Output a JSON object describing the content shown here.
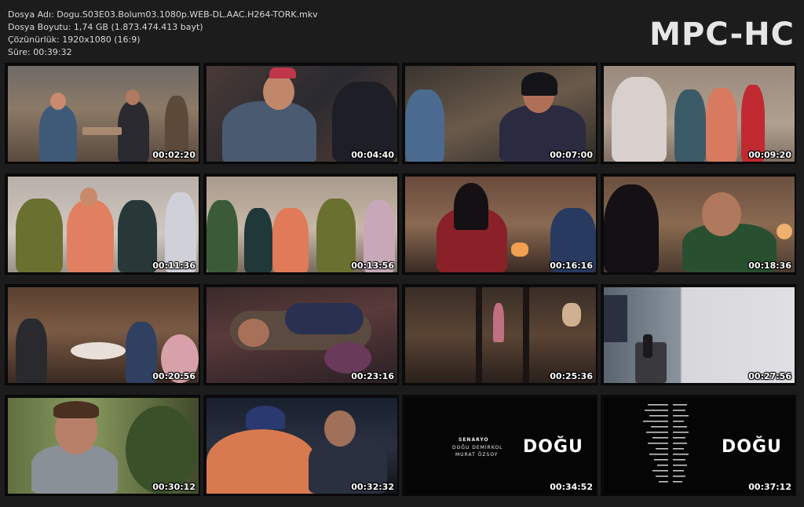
{
  "file_info": {
    "name_line": "Dosya Adı: Dogu.S03E03.Bolum03.1080p.WEB-DL.AAC.H264-TORK.mkv",
    "size_line": "Dosya Boyutu: 1,74 GB (1.873.474.413 bayt)",
    "resolution_line": "Çözünürlük: 1920x1080 (16:9)",
    "duration_line": "Süre: 00:39:32"
  },
  "logo": "MPC-HC",
  "thumbnails": [
    {
      "time": "00:02:20"
    },
    {
      "time": "00:04:40"
    },
    {
      "time": "00:07:00"
    },
    {
      "time": "00:09:20"
    },
    {
      "time": "00:11:36"
    },
    {
      "time": "00:13:56"
    },
    {
      "time": "00:16:16"
    },
    {
      "time": "00:18:36"
    },
    {
      "time": "00:20:56"
    },
    {
      "time": "00:23:16"
    },
    {
      "time": "00:25:36"
    },
    {
      "time": "00:27:56"
    },
    {
      "time": "00:30:12"
    },
    {
      "time": "00:32:32"
    },
    {
      "time": "00:34:52"
    },
    {
      "time": "00:37:12"
    }
  ],
  "credits": {
    "senaryo_label": "SENARYO",
    "writer_1": "DOĞU DEMİRKOL",
    "writer_2": "MURAT ÖZSOY",
    "title": "DOĞU"
  },
  "colors": {
    "background": "#1c1c1c",
    "text": "#d8d8d8",
    "timestamp": "#ffffff"
  }
}
